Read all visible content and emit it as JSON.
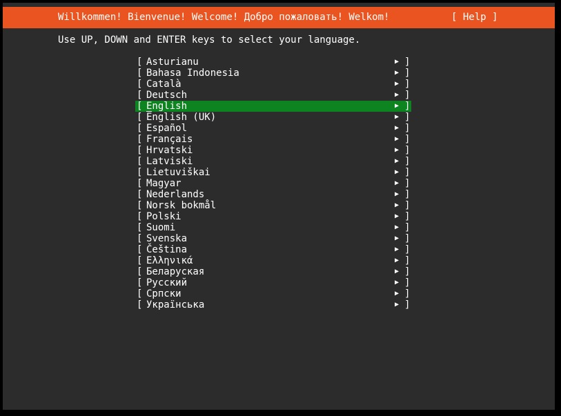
{
  "header": {
    "title": "Willkommen! Bienvenue! Welcome! Добро пожаловать! Welkom!",
    "help_label": "[ Help ]"
  },
  "instructions": "Use UP, DOWN and ENTER keys to select your language.",
  "list": {
    "left_bracket": "[",
    "right_bracket": "]",
    "arrow": "▶",
    "selected_index": 4,
    "items": [
      {
        "label": "Asturianu"
      },
      {
        "label": "Bahasa Indonesia"
      },
      {
        "label": "Català"
      },
      {
        "label": "Deutsch"
      },
      {
        "label": "English"
      },
      {
        "label": "English (UK)"
      },
      {
        "label": "Español"
      },
      {
        "label": "Français"
      },
      {
        "label": "Hrvatski"
      },
      {
        "label": "Latviski"
      },
      {
        "label": "Lietuviškai"
      },
      {
        "label": "Magyar"
      },
      {
        "label": "Nederlands"
      },
      {
        "label": "Norsk bokmål"
      },
      {
        "label": "Polski"
      },
      {
        "label": "Suomi"
      },
      {
        "label": "Svenska"
      },
      {
        "label": "Čeština"
      },
      {
        "label": "Ελληνικά"
      },
      {
        "label": "Беларуская"
      },
      {
        "label": "Русский"
      },
      {
        "label": "Српски"
      },
      {
        "label": "Українська"
      }
    ]
  },
  "colors": {
    "header_bg": "#e95420",
    "selection_bg": "#0e8420",
    "screen_bg": "#2c2c2c"
  }
}
